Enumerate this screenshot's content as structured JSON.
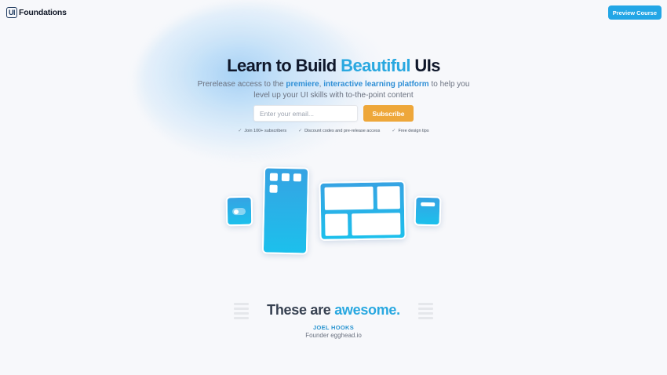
{
  "header": {
    "logo_mark": "UI",
    "logo_text": "Foundations",
    "preview_button": "Preview Course"
  },
  "hero": {
    "title_pre": "Learn to Build ",
    "title_accent": "Beautiful",
    "title_post": " UIs",
    "sub_1": "Prerelease access to the ",
    "sub_b1": "premiere",
    "sub_2": ", ",
    "sub_b2": "interactive learning platform",
    "sub_3": " to help you level up your UI skills with to-the-point content"
  },
  "signup": {
    "email_placeholder": "Enter your email...",
    "subscribe_label": "Subscribe"
  },
  "perks": [
    {
      "icon": "check-icon",
      "label": "Join 100+ subscribers"
    },
    {
      "icon": "check-icon",
      "label": "Discount codes and pre-release access"
    },
    {
      "icon": "check-icon",
      "label": "Free design tips"
    }
  ],
  "testimonial": {
    "headline_pre": "These are ",
    "headline_accent": "awesome.",
    "author": "JOEL HOOKS",
    "role": "Founder egghead.io"
  },
  "colors": {
    "accent": "#29a8e0",
    "button_blue": "#22a6e6",
    "subscribe_orange": "#eea73a"
  }
}
